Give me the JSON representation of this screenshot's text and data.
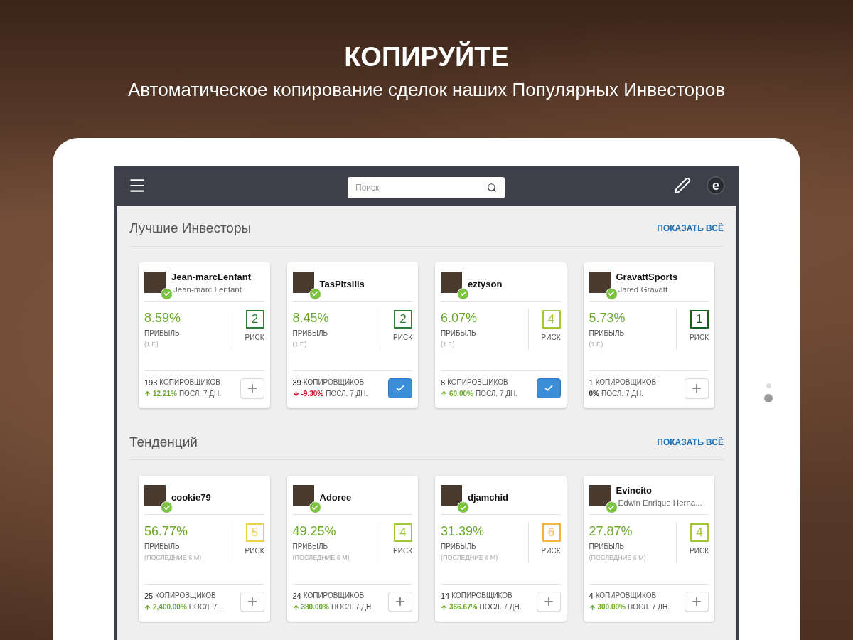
{
  "headline": {
    "title": "КОПИРУЙТЕ",
    "subtitle": "Автоматическое копирование сделок наших Популярных Инвесторов"
  },
  "toolbar": {
    "search": {
      "placeholder": "Поиск"
    },
    "logo": "e"
  },
  "sections": [
    {
      "title": "Лучшие Инвесторы",
      "link": "ПОКАЗАТЬ ВСЁ",
      "cards": [
        {
          "username": "Jean-marcLenfant",
          "full_name": "Jean-marc Lenfant",
          "profit": "8.59%",
          "profit_label": "ПРИБЫЛЬ",
          "period": "(1 Г.)",
          "risk": {
            "value": "2",
            "color": "#2e7d32"
          },
          "risk_label": "РИСК",
          "copiers": "193",
          "copiers_label": "КОПИРОВЩИКОВ",
          "kind": "up",
          "change": "12.21%",
          "change_label": "ПОСЛ. 7 ДН.",
          "copied": false
        },
        {
          "username": "TasPitsilis",
          "profit": "8.45%",
          "profit_label": "ПРИБЫЛЬ",
          "period": "(1 Г.)",
          "risk": {
            "value": "2",
            "color": "#2e7d32"
          },
          "risk_label": "РИСК",
          "copiers": "39",
          "copiers_label": "КОПИРОВЩИКОВ",
          "kind": "down",
          "change": "-9.30%",
          "change_label": "ПОСЛ. 7 ДН.",
          "copied": true
        },
        {
          "username": "eztyson",
          "profit": "6.07%",
          "profit_label": "ПРИБЫЛЬ",
          "period": "(1 Г.)",
          "risk": {
            "value": "4",
            "color": "#a4c639"
          },
          "risk_label": "РИСК",
          "copiers": "8",
          "copiers_label": "КОПИРОВЩИКОВ",
          "kind": "up",
          "change": "60.00%",
          "change_label": "ПОСЛ. 7 ДН.",
          "copied": true
        },
        {
          "username": "GravattSports",
          "full_name": "Jared Gravatt",
          "profit": "5.73%",
          "profit_label": "ПРИБЫЛЬ",
          "period": "(1 Г.)",
          "risk": {
            "value": "1",
            "color": "#1b5e20"
          },
          "risk_label": "РИСК",
          "copiers": "1",
          "copiers_label": "КОПИРОВЩИКОВ",
          "kind": "flat",
          "change": "0%",
          "change_label": "ПОСЛ. 7 ДН.",
          "copied": false
        }
      ]
    },
    {
      "title": "Тенденций",
      "link": "ПОКАЗАТЬ ВСЁ",
      "cards": [
        {
          "username": "cookie79",
          "profit": "56.77%",
          "profit_label": "ПРИБЫЛЬ",
          "period": "(ПОСЛЕДНИЕ 6 М)",
          "risk": {
            "value": "5",
            "color": "#e8d24a"
          },
          "risk_label": "РИСК",
          "copiers": "25",
          "copiers_label": "КОПИРОВЩИКОВ",
          "kind": "up",
          "change": "2,400.00%",
          "change_label": "ПОСЛ. 7...",
          "copied": false
        },
        {
          "username": "Adoree",
          "profit": "49.25%",
          "profit_label": "ПРИБЫЛЬ",
          "period": "(ПОСЛЕДНИЕ 6 М)",
          "risk": {
            "value": "4",
            "color": "#a4c639"
          },
          "risk_label": "РИСК",
          "copiers": "24",
          "copiers_label": "КОПИРОВЩИКОВ",
          "kind": "up",
          "change": "380.00%",
          "change_label": "ПОСЛ. 7 ДН.",
          "copied": false
        },
        {
          "username": "djamchid",
          "profit": "31.39%",
          "profit_label": "ПРИБЫЛЬ",
          "period": "(ПОСЛЕДНИЕ 6 М)",
          "risk": {
            "value": "6",
            "color": "#f5b342"
          },
          "risk_label": "РИСК",
          "copiers": "14",
          "copiers_label": "КОПИРОВЩИКОВ",
          "kind": "up",
          "change": "366.67%",
          "change_label": "ПОСЛ. 7 ДН.",
          "copied": false
        },
        {
          "username": "Evincito",
          "full_name": "Edwin Enrique Herna...",
          "profit": "27.87%",
          "profit_label": "ПРИБЫЛЬ",
          "period": "(ПОСЛЕДНИЕ 6 М)",
          "risk": {
            "value": "4",
            "color": "#a4c639"
          },
          "risk_label": "РИСК",
          "copiers": "4",
          "copiers_label": "КОПИРОВЩИКОВ",
          "kind": "up",
          "change": "300.00%",
          "change_label": "ПОСЛ. 7 ДН.",
          "copied": false
        }
      ]
    }
  ],
  "pager": [
    {
      "selected": false
    },
    {
      "selected": true
    }
  ]
}
